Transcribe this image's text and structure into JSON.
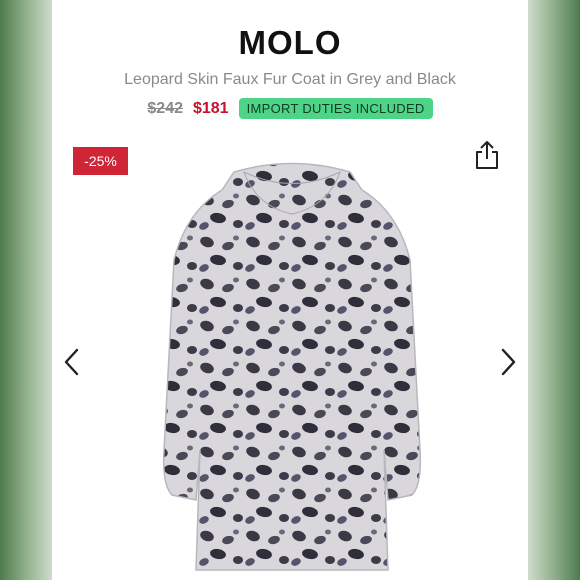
{
  "product": {
    "brand": "MOLO",
    "title": "Leopard Skin Faux Fur Coat in Grey and Black",
    "original_price": "$242",
    "sale_price": "$181",
    "duties_badge": "IMPORT DUTIES INCLUDED",
    "discount_badge": "-25%"
  },
  "icons": {
    "share": "share-icon",
    "prev": "chevron-left-icon",
    "next": "chevron-right-icon"
  },
  "colors": {
    "sale_price": "#c8102e",
    "discount_badge": "#cf2536",
    "duties_badge": "#4ed488",
    "side_background": "#8fb08b"
  }
}
